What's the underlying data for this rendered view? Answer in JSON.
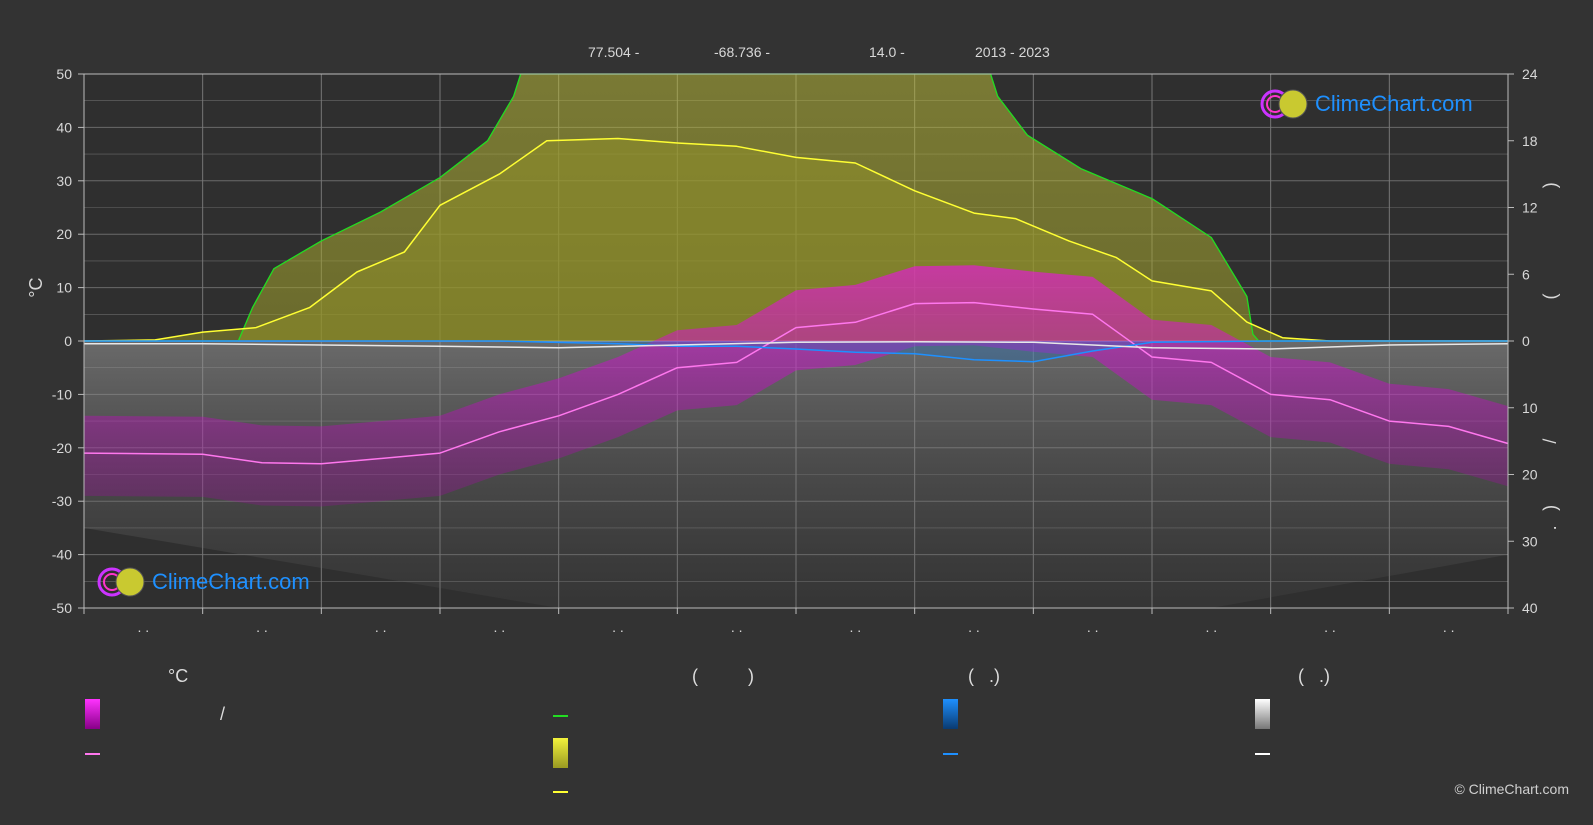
{
  "header": {
    "lat": "77.504 -",
    "lon": "-68.736 -",
    "elev": "14.0 -",
    "years": "2013 - 2023"
  },
  "watermark": "ClimeChart.com",
  "copyright": "© ClimeChart.com",
  "legend": {
    "col1_title": "°C",
    "col1_row1_sep": "/",
    "col2_title": "(          )",
    "col3_title": "(   .)",
    "col4_title": "(   .)"
  },
  "colors": {
    "background": "#333333",
    "temp": "#ff00ff",
    "temp_line": "#ff77ee",
    "daylight": "#22dd22",
    "sunshine": "#d4d43a",
    "sunshine_line": "#ffff33",
    "rain": "#1e90ff",
    "snow": "#e0e0e0",
    "brand": "#1e90ff"
  },
  "chart_data": {
    "type": "line",
    "left_axis": {
      "label": "°C",
      "ylim": [
        -50,
        50
      ],
      "ticks": [
        "50",
        "40",
        "30",
        "20",
        "10",
        "0",
        "-10",
        "-20",
        "-30",
        "-40",
        "-50"
      ]
    },
    "right_axis_top": {
      "ylim": [
        0,
        24
      ],
      "ticks": [
        "24",
        "18",
        "12",
        "6",
        "0"
      ],
      "label_chars": [
        ")",
        "("
      ]
    },
    "right_axis_bottom": {
      "ylim": [
        0,
        40
      ],
      "ticks": [
        "10",
        "20",
        "30",
        "40"
      ],
      "label_chars": [
        "/",
        ")",
        "."
      ]
    },
    "x_ticks": [
      ". .",
      ". .",
      ". .",
      ". .",
      ". .",
      ". .",
      ". .",
      ". .",
      ". .",
      ". .",
      ". .",
      ". ."
    ],
    "grid": true,
    "series": [
      {
        "key": "mean_temp",
        "axis": "temp",
        "x": [
          0,
          1,
          1.5,
          2,
          2.5,
          3,
          3.5,
          4,
          4.5,
          5,
          5.5,
          6,
          6.5,
          7,
          7.5,
          8,
          8.5,
          9,
          9.5,
          10,
          10.5,
          11,
          11.5,
          12
        ],
        "y": [
          -21,
          -21.2,
          -22.8,
          -23,
          -22,
          -21,
          -17,
          -14,
          -10,
          -5,
          -4,
          2.5,
          3.5,
          7,
          7.2,
          6,
          5,
          -3,
          -4,
          -10,
          -11,
          -15,
          -16,
          -19.2
        ]
      },
      {
        "key": "daylight",
        "axis": "hours",
        "x": [
          0,
          1.3,
          1.42,
          1.6,
          2,
          2.5,
          3,
          3.4,
          3.62,
          3.68,
          7.64,
          7.7,
          7.95,
          8.4,
          9,
          9.5,
          9.8,
          9.85,
          9.9,
          12
        ],
        "y": [
          0,
          0,
          3,
          6.5,
          9,
          11.6,
          14.7,
          18,
          22,
          24,
          24,
          22,
          18.5,
          15.5,
          12.8,
          9.3,
          4,
          0.6,
          0,
          0
        ]
      },
      {
        "key": "sunshine",
        "axis": "hours",
        "x": [
          0,
          0.6,
          1,
          1.45,
          1.9,
          2.3,
          2.7,
          3,
          3.5,
          3.9,
          4.5,
          5,
          5.5,
          6,
          6.5,
          7,
          7.5,
          7.85,
          8.3,
          8.7,
          9,
          9.5,
          9.8,
          10.1,
          10.5,
          11,
          12
        ],
        "y": [
          0,
          0.1,
          0.8,
          1.2,
          3,
          6.2,
          8,
          12.2,
          15,
          18,
          18.2,
          17.8,
          17.5,
          16.5,
          16,
          13.5,
          11.5,
          11,
          9,
          7.5,
          5.4,
          4.5,
          1.7,
          0.3,
          0,
          0,
          0
        ]
      },
      {
        "key": "rain",
        "axis": "precip",
        "x": [
          0,
          2,
          3.5,
          4.5,
          5,
          5.5,
          6,
          6.5,
          7,
          7.5,
          8,
          8.5,
          9,
          10,
          12
        ],
        "y": [
          0,
          0,
          0,
          0.4,
          0.8,
          0.8,
          1.2,
          1.7,
          1.9,
          2.8,
          3.1,
          1.5,
          0.2,
          0,
          0
        ]
      },
      {
        "key": "snow",
        "axis": "precip",
        "x": [
          0,
          1,
          2,
          3,
          4,
          5,
          6,
          7,
          8,
          9,
          10,
          11,
          12
        ],
        "y": [
          0.4,
          0.4,
          0.6,
          0.8,
          1,
          0.6,
          0.2,
          0.1,
          0.2,
          1,
          1.2,
          0.6,
          0.4
        ]
      }
    ]
  }
}
